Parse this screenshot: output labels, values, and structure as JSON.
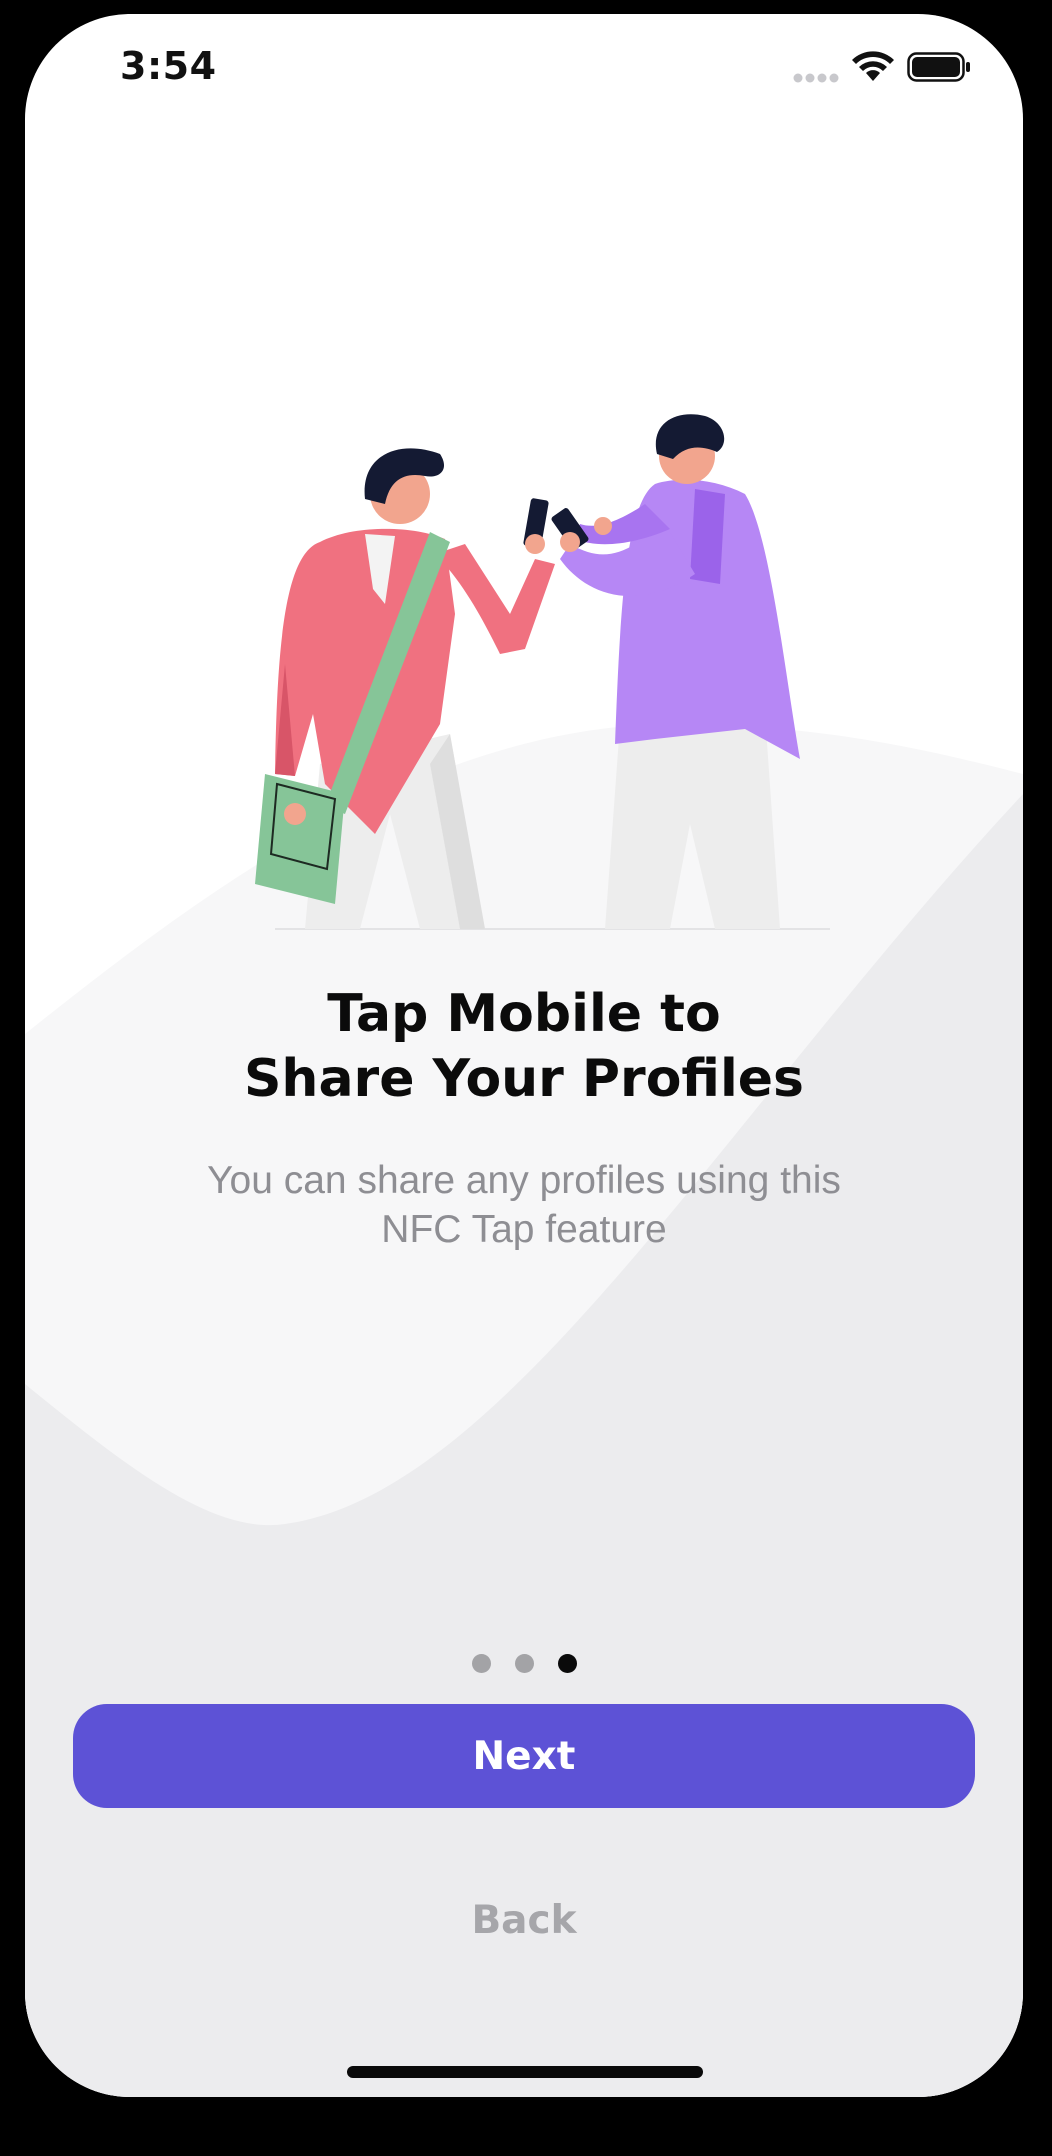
{
  "status_bar": {
    "time": "3:54",
    "icons": [
      "cellular-signal-icon",
      "wifi-icon",
      "battery-icon"
    ]
  },
  "onboarding": {
    "illustration": "two-people-sharing-phones-illustration",
    "title_line1": "Tap Mobile to",
    "title_line2": "Share Your Profiles",
    "subtitle_line1": "You can share any profiles using this",
    "subtitle_line2": "NFC Tap feature",
    "page_count": 3,
    "active_page": 3
  },
  "actions": {
    "next_label": "Next",
    "back_label": "Back"
  },
  "colors": {
    "accent": "#5d52d6",
    "background_wave": "#ececee",
    "title": "#0b0b0b",
    "subtitle": "#8e8e93",
    "back_text": "#a6a6aa"
  }
}
